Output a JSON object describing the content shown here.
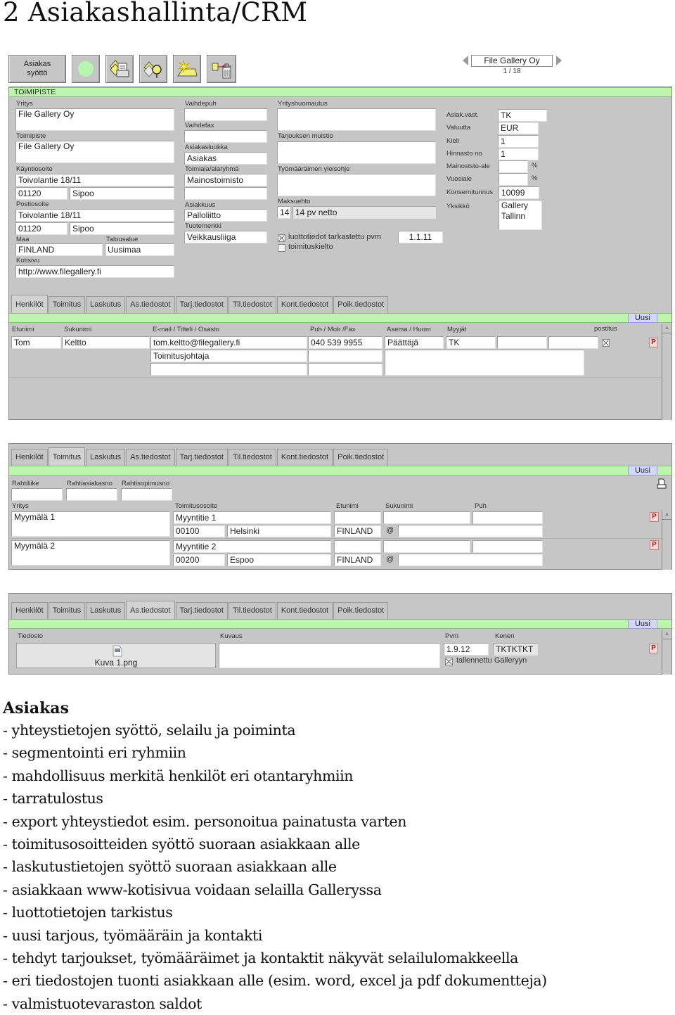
{
  "document": {
    "title": "2 Asiakashallinta/CRM"
  },
  "toolbar": {
    "buttons": [
      {
        "label": "Asiakas\nsyöttö",
        "icon": "text"
      },
      {
        "label": "",
        "icon": "green-dot-icon"
      },
      {
        "label": "",
        "icon": "print-records-icon"
      },
      {
        "label": "",
        "icon": "search-records-icon"
      },
      {
        "label": "",
        "icon": "new-record-icon"
      },
      {
        "label": "",
        "icon": "delete-record-icon"
      }
    ],
    "button_label_line1": "Asiakas",
    "button_label_line2": "syöttö"
  },
  "navigator": {
    "current_record": "File Gallery Oy",
    "position": "1 / 18"
  },
  "toimipiste": {
    "section_title": "TOIMIPISTE",
    "yritys_label": "Yritys",
    "yritys": "File Gallery Oy",
    "toimipiste_label": "Toimipiste",
    "toimipiste": "File Gallery Oy",
    "kayntiosoite_label": "Käyntiosoite",
    "kayntiosoite": "Toivolantie 18/11",
    "kaynti_postinumero": "01120",
    "kaynti_kaupunki": "Sipoo",
    "postiosoite_label": "Postiosoite",
    "postiosoite": "Toivolantie 18/11",
    "posti_postinumero": "01120",
    "posti_kaupunki": "Sipoo",
    "maa_label": "Maa",
    "maa": "FINLAND",
    "talousalue_label": "Talousalue",
    "talousalue": "Uusimaa",
    "kotisivu_label": "Kotisivu",
    "kotisivu": "http://www.filegallery.fi",
    "vaihdepuh_label": "Vaihdepuh",
    "vaihdepuh": "",
    "vaihdefax_label": "Vaihdefax",
    "vaihdefax": "",
    "asiakasluokka_label": "Asiakasluokka",
    "asiakasluokka": "Asiakas",
    "toimiala_label": "Toimiala/alaryhmä",
    "toimiala": "Mainostoimisto",
    "alaryhma": "",
    "asiakkuus_label": "Asiakkuus",
    "asiakkuus": "Palloliitto",
    "tuotemerkki_label": "Tuotemerkki",
    "tuotemerkki": "Veikkausliiga",
    "yrityshuomautus_label": "Yrityshuomautus",
    "yrityshuomautus": "",
    "tarjouksen_muistio_label": "Tarjouksen muistio",
    "tarjouksen_muistio": "",
    "tyomaarain_label": "Työmääräimen yleisohje",
    "tyomaarain": "",
    "maksuehto_label": "Maksuehto",
    "maksuehto_koodi": "14",
    "maksuehto": "14 pv netto",
    "luottotiedot_label": "luottotiedot tarkastettu pvm",
    "luottotiedot_checked": true,
    "luottotiedot_pvm": "1.1.11",
    "toimituskielto_label": "toimituskielto",
    "toimituskielto_checked": false,
    "asiak_vast_label": "Asiak.vast.",
    "asiak_vast": "TK",
    "valuutta_label": "Valuutta",
    "valuutta": "EUR",
    "kieli_label": "Kieli",
    "kieli": "1",
    "hinnasto_label": "Hinnasto no",
    "hinnasto": "1",
    "mainosala_label": "Mainoststo-ale",
    "mainosala": "",
    "percent": "%",
    "vuosiale_label": "Vuosiale",
    "vuosiale": "",
    "konsernitunnus_label": "Konsernitunnus",
    "konsernitunnus": "10099",
    "yksikko_label": "Yksikkö",
    "yksikko": "Gallery Tallinn"
  },
  "tabs": [
    "Henkilöt",
    "Toimitus",
    "Laskutus",
    "As.tiedostot",
    "Tarj.tiedostot",
    "Til.tiedostot",
    "Kont.tiedostot",
    "Poik.tiedostot"
  ],
  "uusi_label": "Uusi",
  "p_label": "P",
  "henkilot": {
    "active_tab": "Henkilöt",
    "headers": {
      "etunimi": "Etunimi",
      "sukunimi": "Sukunimi",
      "email": "E-mail / Titteli / Osasto",
      "puh": "Puh / Mob /Fax",
      "asema": "Asema / Huom",
      "myyjat": "Myyjät",
      "postitus": "postitus"
    },
    "rows": [
      {
        "etunimi": "Tom",
        "sukunimi": "Keltto",
        "email": "tom.keltto@filegallery.fi",
        "titteli": "Toimitusjohtaja",
        "osasto": "",
        "puh": "040 539 9955",
        "mob": "",
        "fax": "",
        "asema": "Päättäjä",
        "huom": "",
        "myyja1": "TK",
        "myyja2": "",
        "myyja3": "",
        "postitus": true
      }
    ]
  },
  "toimitus": {
    "active_tab": "Toimitus",
    "rahtiliike_label": "Rahtiliike",
    "rahtiasiakasno_label": "Rahtiasiakasno",
    "rahtisopimusno_label": "Rahtisopimusno",
    "rahtiliike": "",
    "rahtiasiakasno": "",
    "rahtisopimusno": "",
    "headers": {
      "yritys": "Yritys",
      "toimitusosoite": "Toimitusosoite",
      "etunimi": "Etunimi",
      "sukunimi": "Sukunimi",
      "puh": "Puh"
    },
    "at_sign": "@",
    "rows": [
      {
        "yritys": "Myymälä 1",
        "osoite": "Myyntitie 1",
        "postinumero": "00100",
        "kaupunki": "Helsinki",
        "maa": "FINLAND",
        "etunimi": "",
        "sukunimi": "",
        "puh": "",
        "email": ""
      },
      {
        "yritys": "Myymälä 2",
        "osoite": "Myyntitie 2",
        "postinumero": "00200",
        "kaupunki": "Espoo",
        "maa": "FINLAND",
        "etunimi": "",
        "sukunimi": "",
        "puh": "",
        "email": ""
      }
    ]
  },
  "tiedostot": {
    "active_tab": "As.tiedostot",
    "headers": {
      "tiedosto": "Tiedosto",
      "kuvaus": "Kuvaus",
      "pvm": "Pvm",
      "kenen": "Kenen"
    },
    "rows": [
      {
        "tiedosto": "Kuva 1.png",
        "kuvaus": "",
        "pvm": "1.9.12",
        "kenen": "TKTKTKT",
        "tallennettu_label": "tallennettu Galleryyn",
        "tallennettu": true
      }
    ]
  },
  "features": {
    "heading": "Asiakas",
    "items": [
      "- yhteystietojen syöttö, selailu ja poiminta",
      "- segmentointi eri ryhmiin",
      "- mahdollisuus merkitä henkilöt eri otantaryhmiin",
      "- tarratulostus",
      "- export yhteystiedot esim. personoitua painatusta varten",
      "- toimitusosoitteiden syöttö suoraan asiakkaan alle",
      "- laskutustietojen syöttö suoraan asiakkaan alle",
      "- asiakkaan www-kotisivua voidaan selailla Galleryssa",
      "- luottotietojen tarkistus",
      "- uusi tarjous, työmääräin ja kontakti",
      "- tehdyt tarjoukset, työmääräimet ja kontaktit näkyvät selailulomakkeella",
      "- eri tiedostojen tuonti asiakkaan alle (esim. word, excel ja pdf dokumentteja)",
      "- valmistuotevaraston saldot"
    ]
  }
}
